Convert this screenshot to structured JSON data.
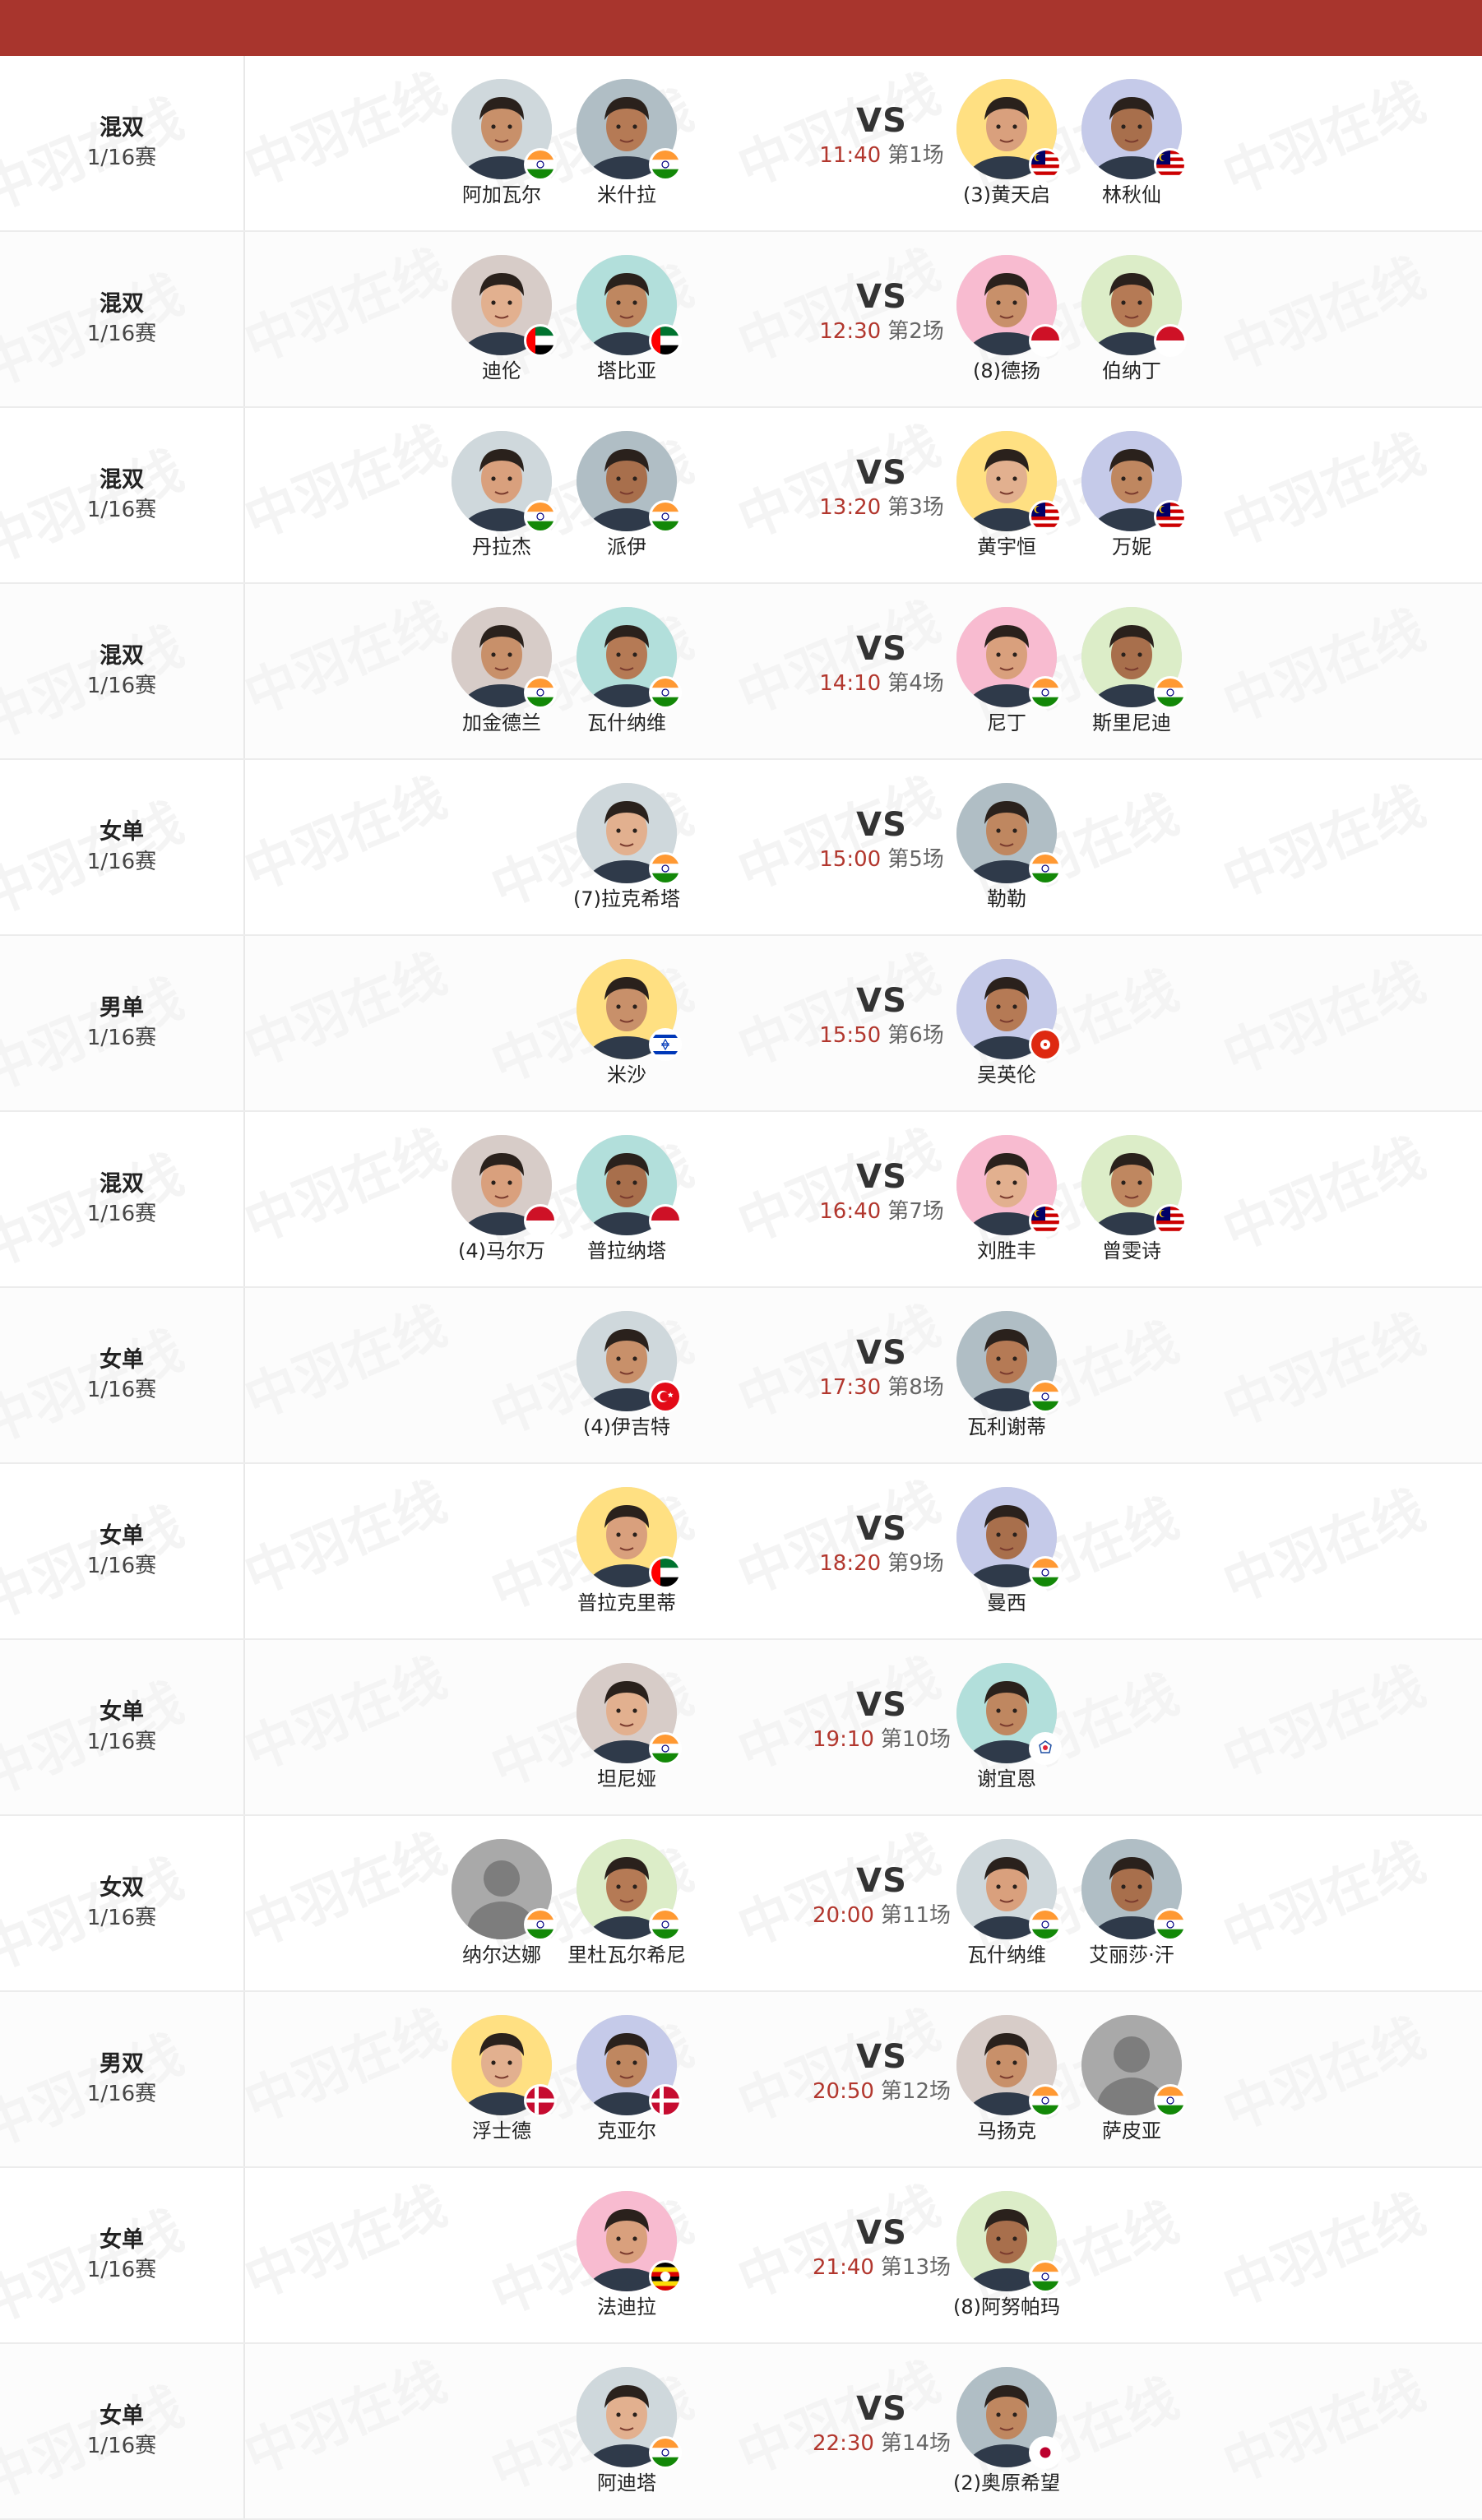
{
  "colors": {
    "header": "#a8352d",
    "time": "#b2372e"
  },
  "vs_label": "VS",
  "watermark": "中羽在线",
  "matches": [
    {
      "type": "混双",
      "round": "1/16赛",
      "time": "11:40",
      "court": "第1场",
      "left": [
        {
          "name": "阿加瓦尔",
          "flag": "india"
        },
        {
          "name": "米什拉",
          "flag": "india"
        }
      ],
      "right": [
        {
          "name": "(3)黄天启",
          "flag": "malaysia"
        },
        {
          "name": "林秋仙",
          "flag": "malaysia"
        }
      ]
    },
    {
      "type": "混双",
      "round": "1/16赛",
      "time": "12:30",
      "court": "第2场",
      "left": [
        {
          "name": "迪伦",
          "flag": "uae"
        },
        {
          "name": "塔比亚",
          "flag": "uae"
        }
      ],
      "right": [
        {
          "name": "(8)德扬",
          "flag": "indonesia"
        },
        {
          "name": "伯纳丁",
          "flag": "indonesia"
        }
      ]
    },
    {
      "type": "混双",
      "round": "1/16赛",
      "time": "13:20",
      "court": "第3场",
      "left": [
        {
          "name": "丹拉杰",
          "flag": "india"
        },
        {
          "name": "派伊",
          "flag": "india"
        }
      ],
      "right": [
        {
          "name": "黄宇恒",
          "flag": "malaysia"
        },
        {
          "name": "万妮",
          "flag": "malaysia"
        }
      ]
    },
    {
      "type": "混双",
      "round": "1/16赛",
      "time": "14:10",
      "court": "第4场",
      "left": [
        {
          "name": "加金德兰",
          "flag": "india"
        },
        {
          "name": "瓦什纳维",
          "flag": "india"
        }
      ],
      "right": [
        {
          "name": "尼丁",
          "flag": "india"
        },
        {
          "name": "斯里尼迪",
          "flag": "india"
        }
      ]
    },
    {
      "type": "女单",
      "round": "1/16赛",
      "time": "15:00",
      "court": "第5场",
      "left": [
        {
          "name": "(7)拉克希塔",
          "flag": "india"
        }
      ],
      "right": [
        {
          "name": "勒勒",
          "flag": "india"
        }
      ]
    },
    {
      "type": "男单",
      "round": "1/16赛",
      "time": "15:50",
      "court": "第6场",
      "left": [
        {
          "name": "米沙",
          "flag": "israel"
        }
      ],
      "right": [
        {
          "name": "吴英伦",
          "flag": "hongkong"
        }
      ]
    },
    {
      "type": "混双",
      "round": "1/16赛",
      "time": "16:40",
      "court": "第7场",
      "left": [
        {
          "name": "(4)马尔万",
          "flag": "indonesia"
        },
        {
          "name": "普拉纳塔",
          "flag": "indonesia"
        }
      ],
      "right": [
        {
          "name": "刘胜丰",
          "flag": "malaysia"
        },
        {
          "name": "曾雯诗",
          "flag": "malaysia"
        }
      ]
    },
    {
      "type": "女单",
      "round": "1/16赛",
      "time": "17:30",
      "court": "第8场",
      "left": [
        {
          "name": "(4)伊吉特",
          "flag": "turkey"
        }
      ],
      "right": [
        {
          "name": "瓦利谢蒂",
          "flag": "india"
        }
      ]
    },
    {
      "type": "女单",
      "round": "1/16赛",
      "time": "18:20",
      "court": "第9场",
      "left": [
        {
          "name": "普拉克里蒂",
          "flag": "uae"
        }
      ],
      "right": [
        {
          "name": "曼西",
          "flag": "india"
        }
      ]
    },
    {
      "type": "女单",
      "round": "1/16赛",
      "time": "19:10",
      "court": "第10场",
      "left": [
        {
          "name": "坦尼娅",
          "flag": "india"
        }
      ],
      "right": [
        {
          "name": "谢宜恩",
          "flag": "taipei"
        }
      ]
    },
    {
      "type": "女双",
      "round": "1/16赛",
      "time": "20:00",
      "court": "第11场",
      "left": [
        {
          "name": "纳尔达娜",
          "flag": "india",
          "silhouette": true
        },
        {
          "name": "里杜瓦尔希尼",
          "flag": "india"
        }
      ],
      "right": [
        {
          "name": "瓦什纳维",
          "flag": "india"
        },
        {
          "name": "艾丽莎·汗",
          "flag": "india"
        }
      ]
    },
    {
      "type": "男双",
      "round": "1/16赛",
      "time": "20:50",
      "court": "第12场",
      "left": [
        {
          "name": "浮士德",
          "flag": "denmark"
        },
        {
          "name": "克亚尔",
          "flag": "denmark"
        }
      ],
      "right": [
        {
          "name": "马扬克",
          "flag": "india"
        },
        {
          "name": "萨皮亚",
          "flag": "india",
          "silhouette": true
        }
      ]
    },
    {
      "type": "女单",
      "round": "1/16赛",
      "time": "21:40",
      "court": "第13场",
      "left": [
        {
          "name": "法迪拉",
          "flag": "uganda"
        }
      ],
      "right": [
        {
          "name": "(8)阿努帕玛",
          "flag": "india"
        }
      ]
    },
    {
      "type": "女单",
      "round": "1/16赛",
      "time": "22:30",
      "court": "第14场",
      "left": [
        {
          "name": "阿迪塔",
          "flag": "india"
        }
      ],
      "right": [
        {
          "name": "(2)奥原希望",
          "flag": "japan"
        }
      ]
    }
  ]
}
